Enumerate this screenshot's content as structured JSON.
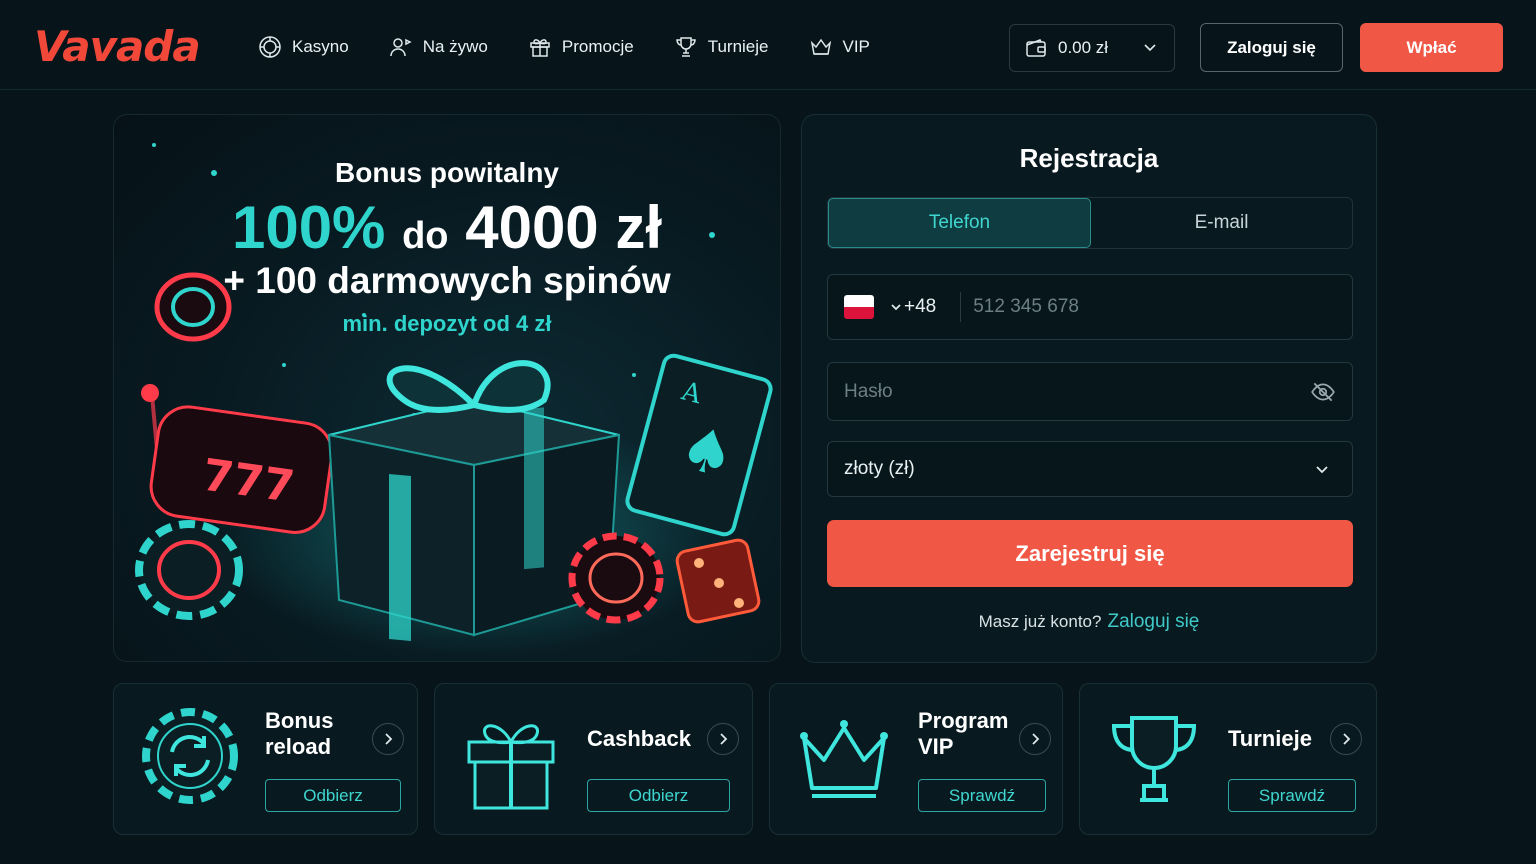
{
  "header": {
    "logo": "Vavada",
    "nav": [
      {
        "label": "Kasyno",
        "icon": "casino-chip-icon"
      },
      {
        "label": "Na żywo",
        "icon": "live-dealer-icon"
      },
      {
        "label": "Promocje",
        "icon": "gift-icon"
      },
      {
        "label": "Turnieje",
        "icon": "trophy-icon"
      },
      {
        "label": "VIP",
        "icon": "crown-icon"
      }
    ],
    "balance": "0.00 zł",
    "login_label": "Zaloguj się",
    "deposit_label": "Wpłać"
  },
  "promo": {
    "line1": "Bonus powitalny",
    "percent": "100%",
    "upto": "do",
    "amount": "4000 zł",
    "line3": "+ 100 darmowych spinów",
    "line4": "min. depozyt od 4 zł"
  },
  "registration": {
    "title": "Rejestracja",
    "tabs": [
      "Telefon",
      "E-mail"
    ],
    "active_tab": "Telefon",
    "country_code": "+48",
    "phone_placeholder": "512 345 678",
    "password_placeholder": "Hasło",
    "currency": "złoty (zł)",
    "submit_label": "Zarejestruj się",
    "have_account": "Masz już konto?",
    "login_link": "Zaloguj się"
  },
  "cards": [
    {
      "title_1": "Bonus",
      "title_2": "reload",
      "button": "Odbierz"
    },
    {
      "title_1": "Cashback",
      "title_2": "",
      "button": "Odbierz"
    },
    {
      "title_1": "Program",
      "title_2": "VIP",
      "button": "Sprawdź"
    },
    {
      "title_1": "Turnieje",
      "title_2": "",
      "button": "Sprawdź"
    }
  ],
  "colors": {
    "accent": "#f15745",
    "teal": "#2fd5cc",
    "background": "#07151b"
  }
}
